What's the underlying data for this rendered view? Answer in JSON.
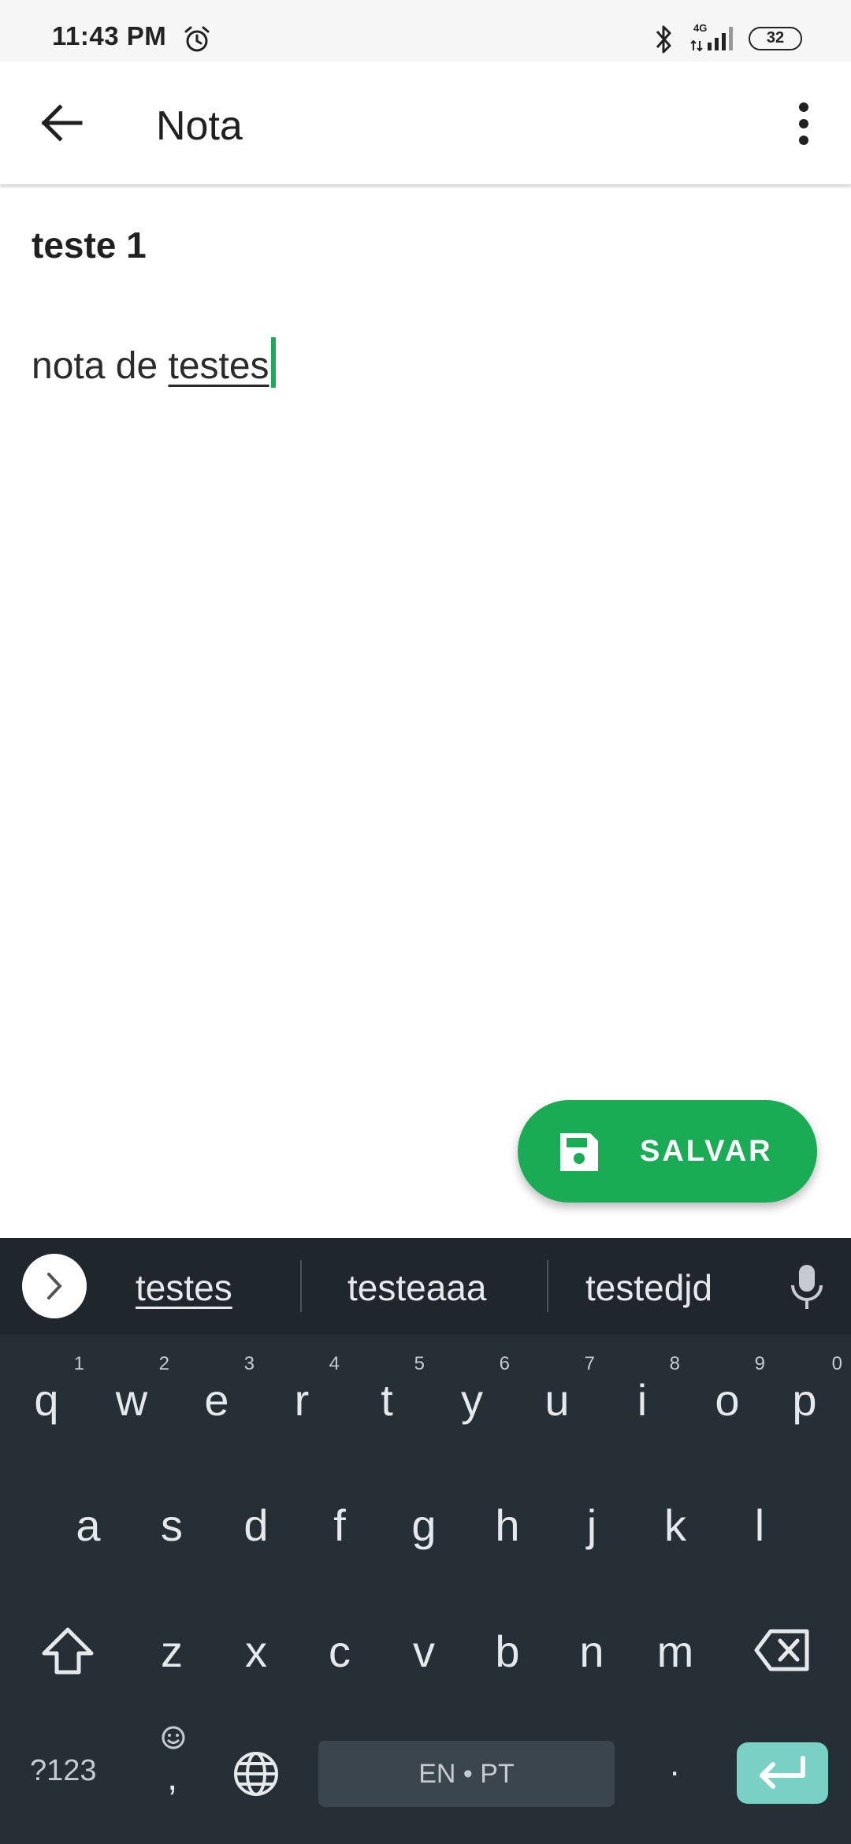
{
  "status_bar": {
    "time": "11:43 PM",
    "network": "4G",
    "battery": "32"
  },
  "app_bar": {
    "title": "Nota"
  },
  "note": {
    "title": "teste 1",
    "body_plain": "nota de ",
    "body_composing": "testes"
  },
  "fab": {
    "label": "SALVAR"
  },
  "keyboard": {
    "suggestions": [
      "testes",
      "testeaaa",
      "testedjd"
    ],
    "row1": [
      {
        "char": "q",
        "hint": "1"
      },
      {
        "char": "w",
        "hint": "2"
      },
      {
        "char": "e",
        "hint": "3"
      },
      {
        "char": "r",
        "hint": "4"
      },
      {
        "char": "t",
        "hint": "5"
      },
      {
        "char": "y",
        "hint": "6"
      },
      {
        "char": "u",
        "hint": "7"
      },
      {
        "char": "i",
        "hint": "8"
      },
      {
        "char": "o",
        "hint": "9"
      },
      {
        "char": "p",
        "hint": "0"
      }
    ],
    "row2": [
      "a",
      "s",
      "d",
      "f",
      "g",
      "h",
      "j",
      "k",
      "l"
    ],
    "row3": [
      "z",
      "x",
      "c",
      "v",
      "b",
      "n",
      "m"
    ],
    "symbols_label": "?123",
    "comma_label": ",",
    "space_label": "EN • PT",
    "period_label": "."
  },
  "colors": {
    "accent": "#1aab55",
    "keyboard_bg": "#262f36",
    "enter_key": "#79d0c4"
  }
}
